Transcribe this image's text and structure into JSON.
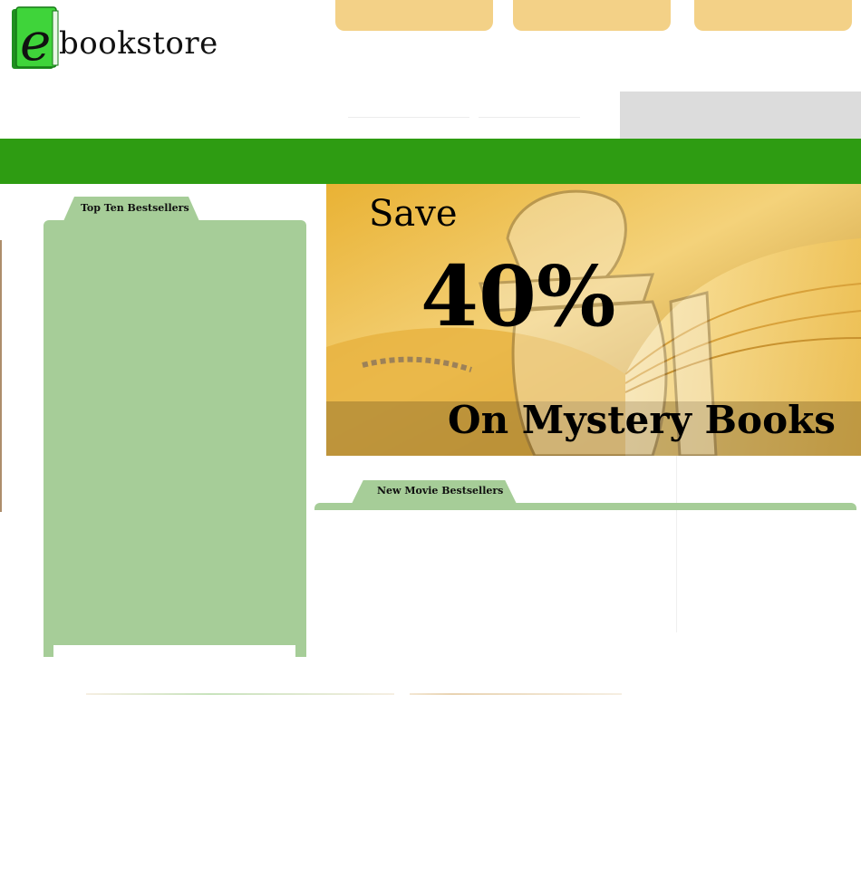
{
  "logo": {
    "letter": "e",
    "word": "bookstore"
  },
  "nav_tabs": [
    {
      "label": ""
    },
    {
      "label": ""
    },
    {
      "label": ""
    }
  ],
  "sidebar": {
    "tab_title": "Top Ten Bestsellers"
  },
  "promo": {
    "line1": "Save",
    "line2": "40%",
    "line3": "On Mystery Books"
  },
  "movies": {
    "tab_title": "New Movie Bestsellers"
  },
  "colors": {
    "nav_tab": "#f3d187",
    "green_bar": "#2e9c12",
    "panel_green": "#a6cd98",
    "grey_panel": "#dcdcdc"
  }
}
